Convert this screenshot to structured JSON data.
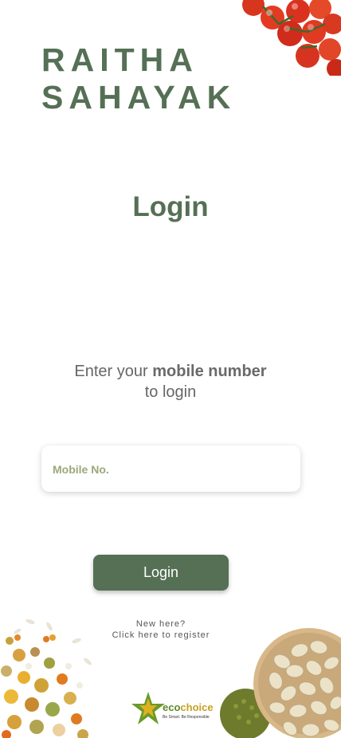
{
  "brand": {
    "line1": "RAITHA",
    "line2": "SAHAYAK"
  },
  "page_title": "Login",
  "prompt": {
    "lead": "Enter your ",
    "emphasis": "mobile number",
    "tail": "to login"
  },
  "mobile_field": {
    "placeholder": "Mobile No.",
    "value": ""
  },
  "login_button": {
    "label": "Login"
  },
  "register_link": {
    "line1": "New here?",
    "line2": "Click here to register"
  },
  "footer_logo": {
    "eco": "eco",
    "choice": "choice",
    "tagline": "Be Smart. Be Responsible"
  },
  "colors": {
    "brand_green": "#557055",
    "tomato_red": "#d9321e",
    "pistachio": "#e6dcc0"
  }
}
